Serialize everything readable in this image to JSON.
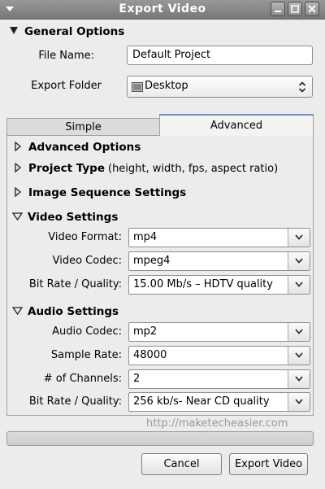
{
  "window": {
    "title": "Export Video"
  },
  "general": {
    "heading": "General Options",
    "file_name_label": "File Name:",
    "file_name_value": "Default Project",
    "export_folder_label": "Export Folder",
    "export_folder_value": "Desktop"
  },
  "tabs": [
    {
      "label": "Simple",
      "selected": false
    },
    {
      "label": "Advanced",
      "selected": true
    }
  ],
  "advanced": {
    "advanced_options": "Advanced Options",
    "project_type": "Project Type",
    "project_type_hint": "(height, width, fps, aspect ratio)",
    "image_sequence": "Image Sequence Settings"
  },
  "video": {
    "heading": "Video Settings",
    "format_label": "Video Format:",
    "format_value": "mp4",
    "codec_label": "Video Codec:",
    "codec_value": "mpeg4",
    "bitrate_label": "Bit Rate / Quality:",
    "bitrate_value": "15.00 Mb/s – HDTV quality"
  },
  "audio": {
    "heading": "Audio Settings",
    "codec_label": "Audio Codec:",
    "codec_value": "mp2",
    "sample_rate_label": "Sample Rate:",
    "sample_rate_value": "48000",
    "channels_label": "# of Channels:",
    "channels_value": "2",
    "bitrate_label": "Bit Rate / Quality:",
    "bitrate_value": "256 kb/s- Near CD quality"
  },
  "watermark": "http://maketecheasier.com",
  "buttons": {
    "cancel": "Cancel",
    "export": "Export Video"
  },
  "progress": {
    "value": 0
  },
  "icons": {
    "window_menu": "window-menu-icon",
    "folder": "folder-icon",
    "minimize": "minimize-icon",
    "maximize": "maximize-icon",
    "close": "close-icon"
  },
  "colors": {
    "titlebar": "#8a8886",
    "background": "#edeceb",
    "watermark": "#9a9896"
  }
}
